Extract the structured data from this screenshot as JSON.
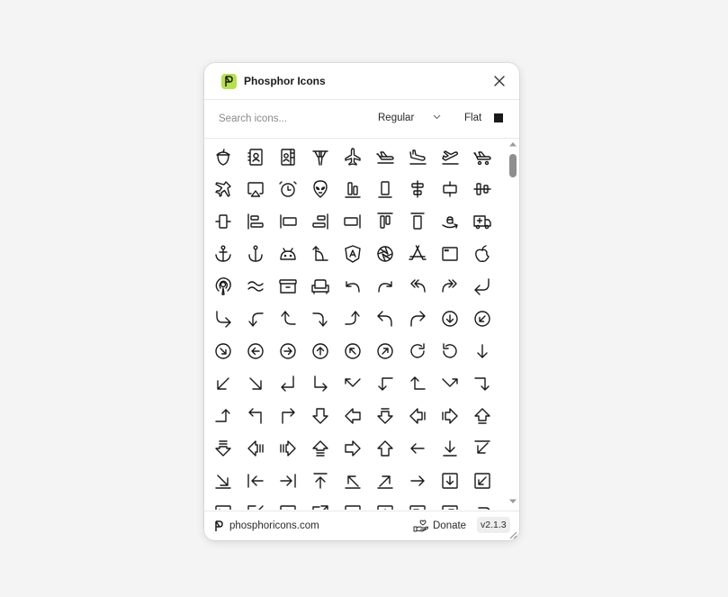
{
  "header": {
    "title": "Phosphor Icons"
  },
  "toolbar": {
    "search_placeholder": "Search icons...",
    "weight": "Regular",
    "mode": "Flat",
    "color": "#1a1a1a"
  },
  "icons": [
    "acorn-icon",
    "address-book-icon",
    "address-book-tabs-icon",
    "air-traffic-control-icon",
    "airplane-icon",
    "airplane-in-flight-icon",
    "airplane-landing-icon",
    "airplane-takeoff-icon",
    "airplane-taxiing-icon",
    "airplane-tilt-icon",
    "airplay-icon",
    "alarm-icon",
    "alien-icon",
    "align-bottom-icon",
    "align-bottom-simple-icon",
    "align-center-horizontal-icon",
    "align-center-horizontal-simple-icon",
    "align-center-vertical-icon",
    "align-center-vertical-simple-icon",
    "align-left-icon",
    "align-left-simple-icon",
    "align-right-icon",
    "align-right-simple-icon",
    "align-top-icon",
    "align-top-simple-icon",
    "amazon-logo-icon",
    "ambulance-icon",
    "anchor-icon",
    "anchor-simple-icon",
    "android-logo-icon",
    "angle-icon",
    "angular-logo-icon",
    "aperture-icon",
    "app-store-logo-icon",
    "app-window-icon",
    "apple-logo-icon",
    "apple-podcasts-logo-icon",
    "approximate-equals-icon",
    "archive-icon",
    "armchair-icon",
    "arrow-arc-left-icon",
    "arrow-arc-right-icon",
    "arrow-bend-double-up-left-icon",
    "arrow-bend-double-up-right-icon",
    "arrow-bend-down-left-icon",
    "arrow-bend-down-right-icon",
    "arrow-bend-left-down-icon",
    "arrow-bend-left-up-icon",
    "arrow-bend-right-down-icon",
    "arrow-bend-right-up-icon",
    "arrow-bend-up-left-icon",
    "arrow-bend-up-right-icon",
    "arrow-circle-down-icon",
    "arrow-circle-down-left-icon",
    "arrow-circle-down-right-icon",
    "arrow-circle-left-icon",
    "arrow-circle-right-icon",
    "arrow-circle-up-icon",
    "arrow-circle-up-left-icon",
    "arrow-circle-up-right-icon",
    "arrow-clockwise-icon",
    "arrow-counter-clockwise-icon",
    "arrow-down-icon",
    "arrow-down-left-icon",
    "arrow-down-right-icon",
    "arrow-elbow-down-left-icon",
    "arrow-elbow-down-right-icon",
    "arrow-elbow-left-icon",
    "arrow-elbow-left-down-icon",
    "arrow-elbow-left-up-icon",
    "arrow-elbow-right-icon",
    "arrow-elbow-right-down-icon",
    "arrow-elbow-right-up-icon",
    "arrow-elbow-up-left-icon",
    "arrow-elbow-up-right-icon",
    "arrow-fat-down-icon",
    "arrow-fat-left-icon",
    "arrow-fat-line-down-icon",
    "arrow-fat-line-left-icon",
    "arrow-fat-line-right-icon",
    "arrow-fat-line-up-icon",
    "arrow-fat-lines-down-icon",
    "arrow-fat-lines-left-icon",
    "arrow-fat-lines-right-icon",
    "arrow-fat-lines-up-icon",
    "arrow-fat-right-icon",
    "arrow-fat-up-icon",
    "arrow-left-icon",
    "arrow-line-down-icon",
    "arrow-line-down-left-icon",
    "arrow-line-down-right-icon",
    "arrow-line-left-icon",
    "arrow-line-right-icon",
    "arrow-line-up-icon",
    "arrow-line-up-left-icon",
    "arrow-line-up-right-icon",
    "arrow-right-icon",
    "arrow-square-down-icon",
    "arrow-square-down-left-icon",
    "arrow-square-down-right-icon",
    "arrow-square-in-icon",
    "arrow-square-left-icon",
    "arrow-square-out-icon",
    "arrow-square-right-icon",
    "arrow-square-up-icon",
    "arrow-square-up-left-icon",
    "arrow-square-up-right-icon",
    "arrow-u-down-left-icon"
  ],
  "footer": {
    "site": "phosphoricons.com",
    "donate": "Donate",
    "version": "v2.1.3"
  }
}
